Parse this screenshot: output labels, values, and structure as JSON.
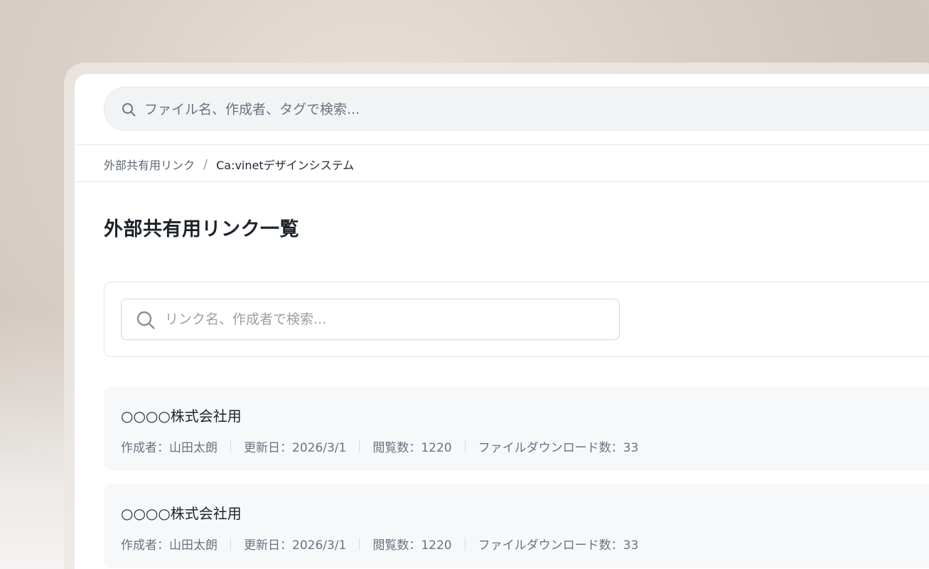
{
  "header": {
    "search_placeholder": "ファイル名、作成者、タグで検索..."
  },
  "breadcrumb": {
    "parent": "外部共有用リンク",
    "separator": "/",
    "current": "Ca:vinetデザインシステム"
  },
  "page": {
    "title": "外部共有用リンク一覧"
  },
  "filter": {
    "search_placeholder": "リンク名、作成者で検索..."
  },
  "links": [
    {
      "name": "○○○○株式会社用",
      "author": "作成者：山田太朗",
      "updated": "更新日：2026/3/1",
      "views": "閲覧数：1220",
      "downloads": "ファイルダウンロード数：33"
    },
    {
      "name": "○○○○株式会社用",
      "author": "作成者：山田太朗",
      "updated": "更新日：2026/3/1",
      "views": "閲覧数：1220",
      "downloads": "ファイルダウンロード数：33"
    }
  ],
  "icons": {
    "search": "search-icon"
  },
  "colors": {
    "text_primary": "#1d232b",
    "text_secondary": "#6b7280",
    "item_background": "#f7f8fa",
    "border": "#e3e6ea"
  }
}
